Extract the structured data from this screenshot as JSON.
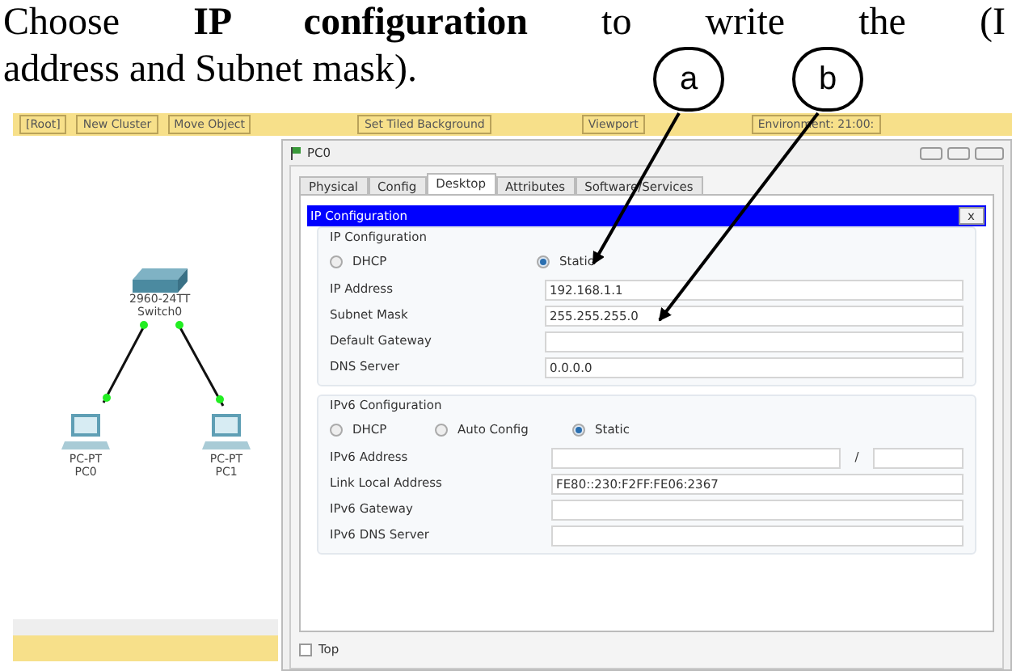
{
  "document_text": [
    "Choose **IP configuration** to write the (I",
    "address and Subnet mask)."
  ],
  "callouts": [
    {
      "label": "a"
    },
    {
      "label": "b"
    }
  ],
  "toolbar": [
    "[Root]",
    "New Cluster",
    "Move Object",
    "Set Tiled Background",
    "Viewport",
    "Environment: 21:00:"
  ],
  "diagram": {
    "nodes": [
      {
        "kind": "switch",
        "model": "2960-24TT",
        "name": "Switch0"
      },
      {
        "kind": "pc",
        "model": "PC-PT",
        "name": "PC0"
      },
      {
        "kind": "pc",
        "model": "PC-PT",
        "name": "PC1"
      }
    ]
  },
  "window": {
    "title": "PC0",
    "tabs": [
      {
        "label": "Physical",
        "selected": false
      },
      {
        "label": "Config",
        "selected": false
      },
      {
        "label": "Desktop",
        "selected": true
      },
      {
        "label": "Attributes",
        "selected": false
      },
      {
        "label": "Software/Services",
        "selected": false
      }
    ],
    "panel": {
      "title": "IP Configuration",
      "close": "x",
      "ipv4": {
        "title": "IP Configuration",
        "modes": [
          {
            "label": "DHCP",
            "selected": false
          },
          {
            "label": "Static",
            "selected": true
          }
        ],
        "fields": [
          {
            "label": "IP Address",
            "value": "192.168.1.1"
          },
          {
            "label": "Subnet Mask",
            "value": "255.255.255.0"
          },
          {
            "label": "Default Gateway"
          },
          {
            "label": "DNS Server",
            "value": "0.0.0.0"
          }
        ]
      },
      "ipv6": {
        "title": "IPv6 Configuration",
        "modes": [
          {
            "label": "DHCP",
            "selected": false
          },
          {
            "label": "Auto Config",
            "selected": false
          },
          {
            "label": "Static",
            "selected": true
          }
        ],
        "fields": [
          {
            "label": "IPv6 Address",
            "kind": "prefix",
            "separator": "/"
          },
          {
            "label": "Link Local Address",
            "value": "FE80::230:F2FF:FE06:2367"
          },
          {
            "label": "IPv6 Gateway"
          },
          {
            "label": "IPv6 DNS Server"
          }
        ]
      }
    },
    "top_checkbox": {
      "label": "Top",
      "checked": false
    }
  }
}
